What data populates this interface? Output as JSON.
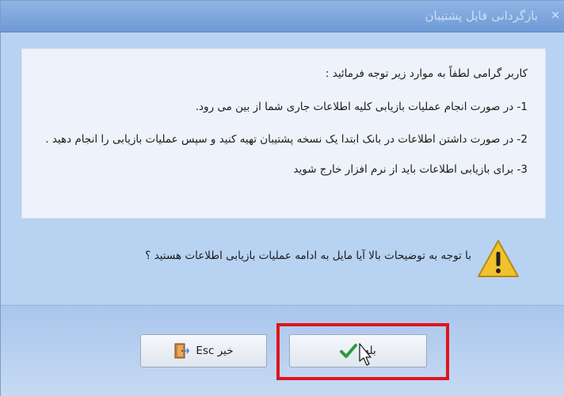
{
  "window": {
    "title": "بازگردانی فایل پشتیبان",
    "close_glyph": "✕"
  },
  "info": {
    "intro": "کاربر گرامی لطفاً به موارد زیر توجه فرمائید :",
    "item1": "1- در صورت انجام عملیات بازیابی کلیه اطلاعات جاری شما از بین می رود.",
    "item2": "2- در صورت داشتن اطلاعات در بانک ابتدا یک نسخه پشتیبان تهیه کنید و سپس عملیات بازیابی را انجام دهید .",
    "item3": "3- برای بازیابی اطلاعات باید از نرم افزار خارج شوید"
  },
  "question": "با توجه به توضیحات بالا آیا مایل به ادامه عملیات بازیابی اطلاعات هستید ؟",
  "buttons": {
    "yes_label": "بله",
    "no_label": "خیر Esc"
  },
  "icons": {
    "warning": "warning-icon",
    "door": "door-exit-icon",
    "check": "check-icon",
    "cursor": "mouse-pointer-icon"
  },
  "colors": {
    "highlight": "#e0151c",
    "warning_fill": "#f2c12e",
    "check": "#2f9a3a"
  }
}
